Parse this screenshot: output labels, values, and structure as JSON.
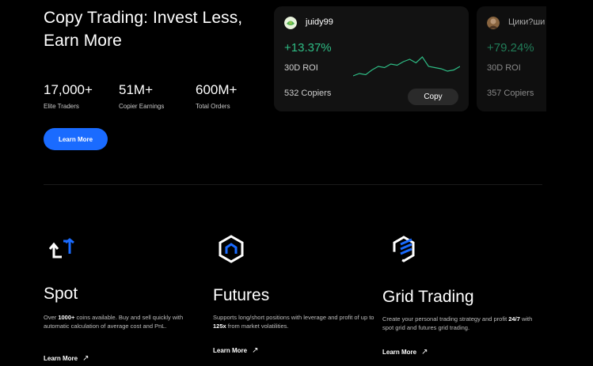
{
  "hero": {
    "title": "Copy Trading: Invest Less, Earn More",
    "learn_more": "Learn More"
  },
  "stats": [
    {
      "value": "17,000+",
      "label": "Elite Traders"
    },
    {
      "value": "51M+",
      "label": "Copier Earnings"
    },
    {
      "value": "600M+",
      "label": "Total Orders"
    }
  ],
  "traders": [
    {
      "name": "juidy99",
      "roi": "+13.37%",
      "roi_label": "30D ROI",
      "copiers": "532 Copiers",
      "copy_label": "Copy",
      "roi_color": "#2ebd85",
      "sparkline": [
        4,
        6,
        5,
        9,
        12,
        11,
        14,
        13,
        16,
        18,
        15,
        20,
        12,
        11,
        10,
        8,
        9,
        12
      ]
    },
    {
      "name": "Цики?ши",
      "roi": "+79.24%",
      "roi_label": "30D ROI",
      "copiers": "357 Copiers",
      "roi_color": "#2ebd85"
    }
  ],
  "features": [
    {
      "title": "Spot",
      "icon": "spot-arrows-icon",
      "desc_parts": [
        "Over ",
        "1000+",
        " coins available. Buy and sell quickly with automatic calculation of average cost and PnL."
      ],
      "learn_more": "Learn More",
      "arrow": "↗"
    },
    {
      "title": "Futures",
      "icon": "futures-hexagon-icon",
      "desc_parts": [
        "Supports long/short positions with leverage and profit of up to ",
        "125x",
        " from market volatilities."
      ],
      "learn_more": "Learn More",
      "arrow": "↗"
    },
    {
      "title": "Grid Trading",
      "icon": "grid-layers-icon",
      "desc_parts": [
        "Create your personal trading strategy and profit ",
        "24/7",
        " with spot grid and futures grid trading."
      ],
      "learn_more": "Learn More",
      "arrow": "↗"
    }
  ],
  "colors": {
    "accent": "#1a6bff",
    "positive": "#2ebd85",
    "background": "#000000",
    "card": "#121212"
  }
}
